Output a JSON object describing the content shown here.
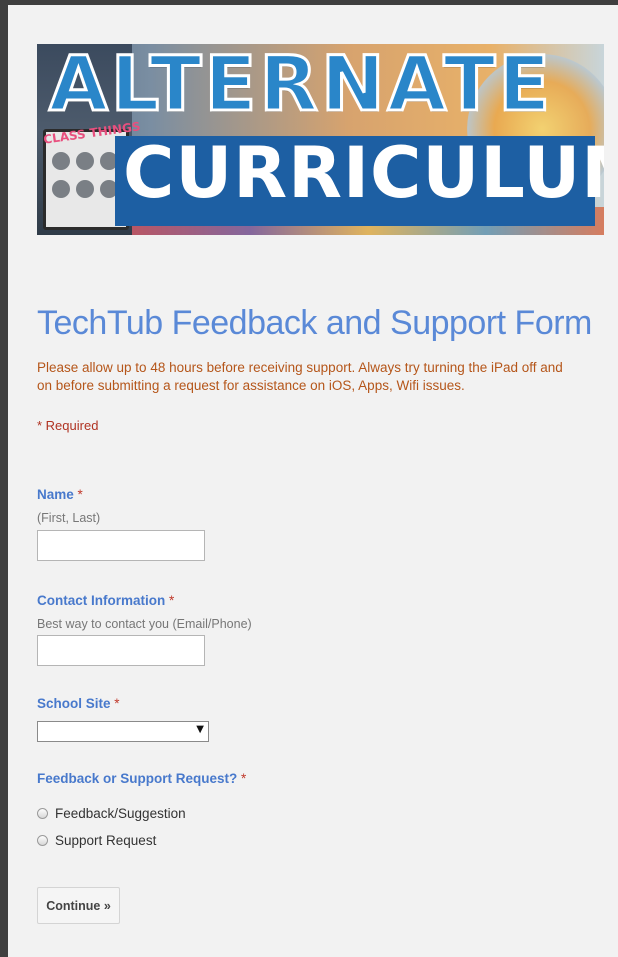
{
  "banner": {
    "word1": "ALTERNATE",
    "word2": "CURRICULUM",
    "board_label": "CLASS THINGS"
  },
  "form": {
    "title": "TechTub Feedback and Support Form",
    "description": "Please allow up to 48 hours before receiving support.  Always try turning the iPad off and on before submitting a request for assistance on iOS, Apps, Wifi issues.",
    "required_note": "* Required",
    "required_marker": "*"
  },
  "questions": {
    "name": {
      "label": "Name",
      "help": "(First, Last)",
      "value": ""
    },
    "contact": {
      "label": "Contact Information",
      "help": "Best way to contact you (Email/Phone)",
      "value": ""
    },
    "school": {
      "label": "School Site",
      "selected": ""
    },
    "request_type": {
      "label": "Feedback or Support Request?",
      "options": [
        "Feedback/Suggestion",
        "Support Request"
      ]
    }
  },
  "actions": {
    "continue_label": "Continue »"
  },
  "colors": {
    "title": "#5a89d7",
    "label": "#4879cc",
    "description": "#b5561a",
    "required": "#b03322",
    "background": "#f2f2f2"
  }
}
